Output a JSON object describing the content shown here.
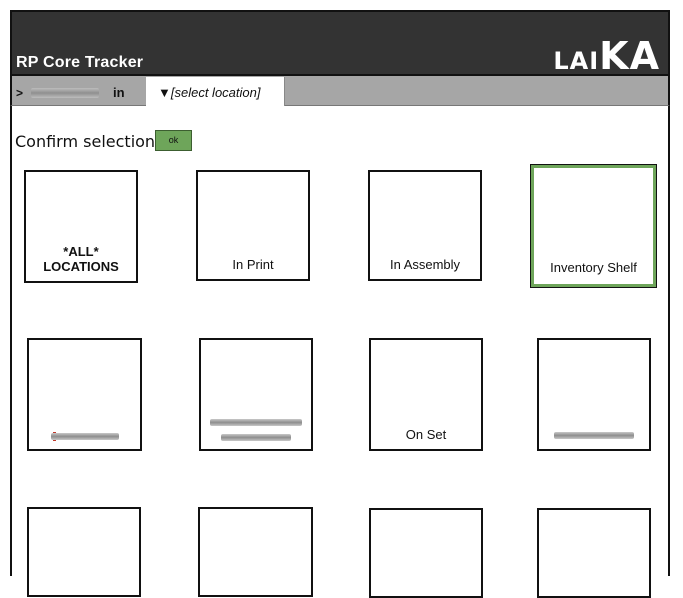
{
  "app": {
    "title": "RP Core Tracker",
    "logo_small": "LAI",
    "logo_big": "KA"
  },
  "breadcrumb": {
    "prefix": ">",
    "connector": "in"
  },
  "location_tab": {
    "label": "▼[select location]"
  },
  "confirm": {
    "label": "Confirm selection",
    "ok_label": "ok"
  },
  "locations": [
    {
      "label": "*ALL* LOCATIONS",
      "selected": false
    },
    {
      "label": "In Print",
      "selected": false
    },
    {
      "label": "In Assembly",
      "selected": false
    },
    {
      "label": "Inventory Shelf",
      "selected": true
    },
    {
      "label": "",
      "selected": false
    },
    {
      "label": "",
      "selected": false
    },
    {
      "label": "On Set",
      "selected": false
    },
    {
      "label": "",
      "selected": false
    },
    {
      "label": "",
      "selected": false
    },
    {
      "label": "",
      "selected": false
    },
    {
      "label": "",
      "selected": false
    },
    {
      "label": "",
      "selected": false
    }
  ],
  "colors": {
    "header_bg": "#333333",
    "breadcrumb_bg": "#a6a6a6",
    "accent_green": "#6ea55a"
  }
}
